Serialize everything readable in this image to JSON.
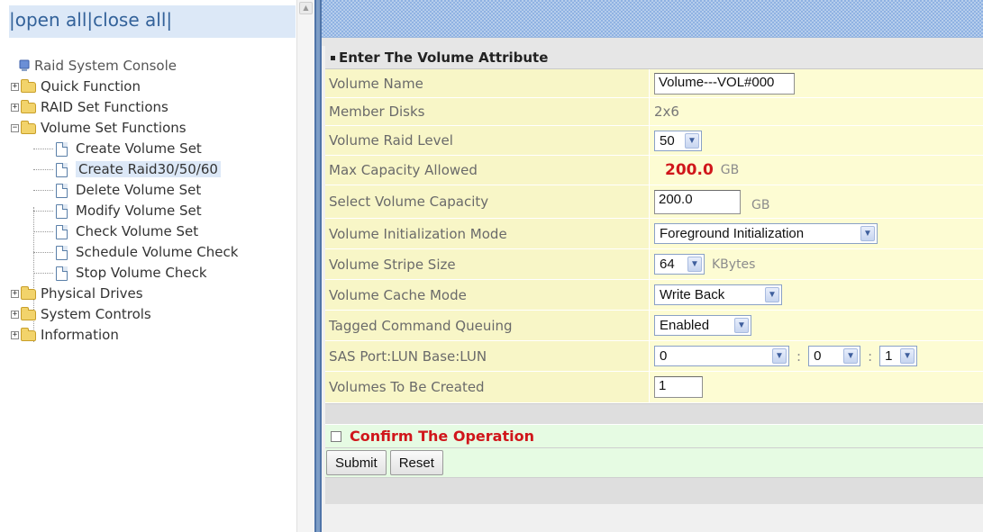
{
  "nav": {
    "open_all": "open all",
    "close_all": "close all",
    "separator": "|"
  },
  "tree": {
    "root": "Raid System Console",
    "items": [
      {
        "label": "Quick Function",
        "expanded": false
      },
      {
        "label": "RAID Set Functions",
        "expanded": false
      },
      {
        "label": "Volume Set Functions",
        "expanded": true,
        "children": [
          "Create Volume Set",
          "Create Raid30/50/60",
          "Delete Volume Set",
          "Modify Volume Set",
          "Check Volume Set",
          "Schedule Volume Check",
          "Stop Volume Check"
        ]
      },
      {
        "label": "Physical Drives",
        "expanded": false
      },
      {
        "label": "System Controls",
        "expanded": false
      },
      {
        "label": "Information",
        "expanded": false
      }
    ],
    "selected": "Create Raid30/50/60"
  },
  "form": {
    "title": "Enter The Volume Attribute",
    "rows": {
      "volume_name": {
        "label": "Volume Name",
        "value": "Volume---VOL#000"
      },
      "member_disks": {
        "label": "Member Disks",
        "value": "2x6"
      },
      "raid_level": {
        "label": "Volume Raid Level",
        "value": "50"
      },
      "max_capacity": {
        "label": "Max Capacity Allowed",
        "value": "200.0",
        "unit": "GB"
      },
      "select_capacity": {
        "label": "Select Volume Capacity",
        "value": "200.0",
        "unit": "GB"
      },
      "init_mode": {
        "label": "Volume Initialization Mode",
        "value": "Foreground Initialization"
      },
      "stripe_size": {
        "label": "Volume Stripe Size",
        "value": "64",
        "unit": "KBytes"
      },
      "cache_mode": {
        "label": "Volume Cache Mode",
        "value": "Write Back"
      },
      "tcq": {
        "label": "Tagged Command Queuing",
        "value": "Enabled"
      },
      "sas_port": {
        "label": "SAS Port:LUN Base:LUN",
        "port": "0",
        "lun_base": "0",
        "lun": "1",
        "sep": ":"
      },
      "volumes_count": {
        "label": "Volumes To Be Created",
        "value": "1"
      }
    },
    "confirm_label": "Confirm The Operation",
    "submit_label": "Submit",
    "reset_label": "Reset"
  },
  "colors": {
    "accent_red": "#d0161b",
    "splitter": "#7d9dc6",
    "row_bg": "#fdfccf",
    "confirm_bg": "#e6fbe3"
  }
}
